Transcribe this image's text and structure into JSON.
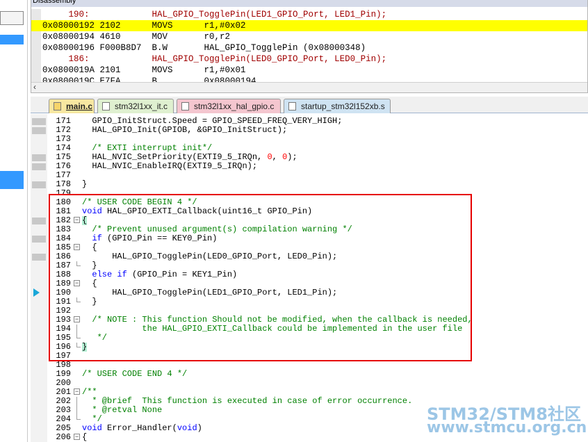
{
  "disassembly": {
    "title": "Disassembly",
    "rows": [
      {
        "text": "     190:            HAL_GPIO_TogglePin(LED1_GPIO_Port, LED1_Pin);",
        "kind": "src"
      },
      {
        "text": "0x08000192 2102      MOVS      r1,#0x02",
        "kind": "hl"
      },
      {
        "text": "0x08000194 4610      MOV       r0,r2",
        "kind": "asm"
      },
      {
        "text": "0x08000196 F000B8D7  B.W       HAL_GPIO_TogglePin (0x08000348)",
        "kind": "asm"
      },
      {
        "text": "     186:            HAL_GPIO_TogglePin(LED0_GPIO_Port, LED0_Pin);",
        "kind": "src"
      },
      {
        "text": "0x0800019A 2101      MOVS      r1,#0x01",
        "kind": "asm"
      },
      {
        "text": "0x0800019C E7FA      B         0x08000194",
        "kind": "asm"
      }
    ]
  },
  "tabs": [
    {
      "label": "main.c",
      "active": true,
      "icon": "file-icon",
      "color": "#f7e7a1"
    },
    {
      "label": "stm32l1xx_it.c",
      "active": false,
      "icon": "file-icon",
      "color": "#dff0d0"
    },
    {
      "label": "stm32l1xx_hal_gpio.c",
      "active": false,
      "icon": "file-icon",
      "color": "#f4c6cf"
    },
    {
      "label": "startup_stm32l152xb.s",
      "active": false,
      "icon": "file-icon",
      "color": "#cfe3f2"
    }
  ],
  "code": [
    {
      "n": "171",
      "t": "  GPIO_InitStruct.Speed = GPIO_SPEED_FREQ_VERY_HIGH;",
      "bp": true
    },
    {
      "n": "172",
      "t": "  HAL_GPIO_Init(GPIOB, &GPIO_InitStruct);",
      "bp": true
    },
    {
      "n": "173",
      "t": "",
      "bp": false
    },
    {
      "n": "174",
      "t": "  /* EXTI interrupt init*/",
      "bp": false,
      "cls": "com"
    },
    {
      "n": "175",
      "t": "  HAL_NVIC_SetPriority(EXTI9_5_IRQn, 0, 0);",
      "bp": true
    },
    {
      "n": "176",
      "t": "  HAL_NVIC_EnableIRQ(EXTI9_5_IRQn);",
      "bp": true
    },
    {
      "n": "177",
      "t": "",
      "bp": false
    },
    {
      "n": "178",
      "t": "}",
      "bp": true
    },
    {
      "n": "179",
      "t": "",
      "bp": false
    },
    {
      "n": "180",
      "t": "/* USER CODE BEGIN 4 */",
      "bp": false,
      "cls": "com"
    },
    {
      "n": "181",
      "t": "void HAL_GPIO_EXTI_Callback(uint16_t GPIO_Pin)",
      "bp": false
    },
    {
      "n": "182",
      "t": "{",
      "bp": true,
      "fold": "open",
      "brace": true
    },
    {
      "n": "183",
      "t": "  /* Prevent unused argument(s) compilation warning */",
      "bp": false,
      "cls": "com"
    },
    {
      "n": "184",
      "t": "  if (GPIO_Pin == KEY0_Pin)",
      "bp": true
    },
    {
      "n": "185",
      "t": "  {",
      "bp": false,
      "fold": "open"
    },
    {
      "n": "186",
      "t": "      HAL_GPIO_TogglePin(LED0_GPIO_Port, LED0_Pin);",
      "bp": true
    },
    {
      "n": "187",
      "t": "  }",
      "bp": false,
      "fold": "end"
    },
    {
      "n": "188",
      "t": "  else if (GPIO_Pin = KEY1_Pin)",
      "bp": false
    },
    {
      "n": "189",
      "t": "  {",
      "bp": false,
      "fold": "open"
    },
    {
      "n": "190",
      "t": "      HAL_GPIO_TogglePin(LED1_GPIO_Port, LED1_Pin);",
      "bp": false,
      "cursor": true
    },
    {
      "n": "191",
      "t": "  }",
      "bp": false,
      "fold": "end"
    },
    {
      "n": "192",
      "t": "",
      "bp": false
    },
    {
      "n": "193",
      "t": "  /* NOTE : This function Should not be modified, when the callback is needed,",
      "bp": false,
      "cls": "com",
      "fold": "open"
    },
    {
      "n": "194",
      "t": "            the HAL_GPIO_EXTI_Callback could be implemented in the user file",
      "bp": false,
      "cls": "com",
      "fold": "line"
    },
    {
      "n": "195",
      "t": "   */",
      "bp": false,
      "cls": "com",
      "fold": "end"
    },
    {
      "n": "196",
      "t": "}",
      "bp": false,
      "fold": "end",
      "brace": true
    },
    {
      "n": "197",
      "t": "",
      "bp": false
    },
    {
      "n": "198",
      "t": "",
      "bp": false
    },
    {
      "n": "199",
      "t": "/* USER CODE END 4 */",
      "bp": false,
      "cls": "com"
    },
    {
      "n": "200",
      "t": "",
      "bp": false
    },
    {
      "n": "201",
      "t": "/**",
      "bp": false,
      "cls": "com",
      "fold": "open"
    },
    {
      "n": "202",
      "t": "  * @brief  This function is executed in case of error occurrence.",
      "bp": false,
      "cls": "com",
      "fold": "line"
    },
    {
      "n": "203",
      "t": "  * @retval None",
      "bp": false,
      "cls": "com",
      "fold": "line"
    },
    {
      "n": "204",
      "t": "  */",
      "bp": false,
      "cls": "com",
      "fold": "end"
    },
    {
      "n": "205",
      "t": "void Error_Handler(void)",
      "bp": false
    },
    {
      "n": "206",
      "t": "{",
      "bp": false,
      "fold": "open"
    }
  ],
  "watermark": {
    "line1": "STM32/STM8社区",
    "line2": "www.stmcu.org.cn"
  },
  "colors": {
    "highlight_line": "#ffff00",
    "comment": "#008000",
    "keyword": "#0000ff",
    "number": "#ff0000",
    "annotation_box": "#e60000",
    "watermark": "#9cc6e6"
  }
}
